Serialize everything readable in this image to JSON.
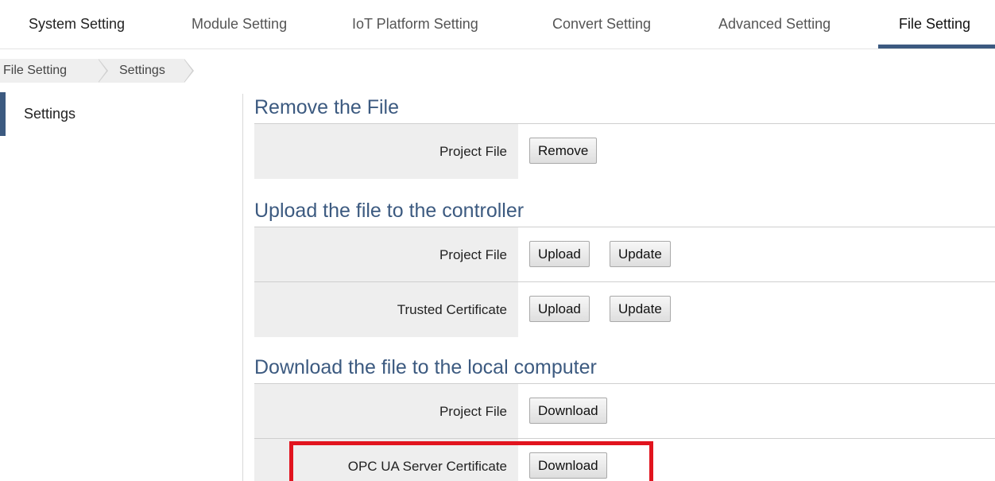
{
  "topnav": {
    "tabs": [
      {
        "label": "System Setting"
      },
      {
        "label": "Module Setting"
      },
      {
        "label": "IoT Platform Setting"
      },
      {
        "label": "Convert Setting"
      },
      {
        "label": "Advanced Setting"
      },
      {
        "label": "File Setting"
      }
    ],
    "active_tab": "File Setting"
  },
  "breadcrumb": [
    "File Setting",
    "Settings"
  ],
  "sidebar": {
    "items": [
      {
        "label": "Settings"
      }
    ]
  },
  "sections": {
    "remove": {
      "title": "Remove the File",
      "rows": [
        {
          "label": "Project File",
          "buttons": [
            "Remove"
          ]
        }
      ]
    },
    "upload": {
      "title": "Upload the file to the controller",
      "rows": [
        {
          "label": "Project File",
          "buttons": [
            "Upload",
            "Update"
          ]
        },
        {
          "label": "Trusted Certificate",
          "buttons": [
            "Upload",
            "Update"
          ]
        }
      ]
    },
    "download": {
      "title": "Download the file to the local computer",
      "rows": [
        {
          "label": "Project File",
          "buttons": [
            "Download"
          ]
        },
        {
          "label": "OPC UA Server Certificate",
          "buttons": [
            "Download"
          ]
        }
      ]
    }
  },
  "colors": {
    "accent": "#3c5a80",
    "highlight": "#e1141e",
    "label_bg": "#eeeeee"
  }
}
